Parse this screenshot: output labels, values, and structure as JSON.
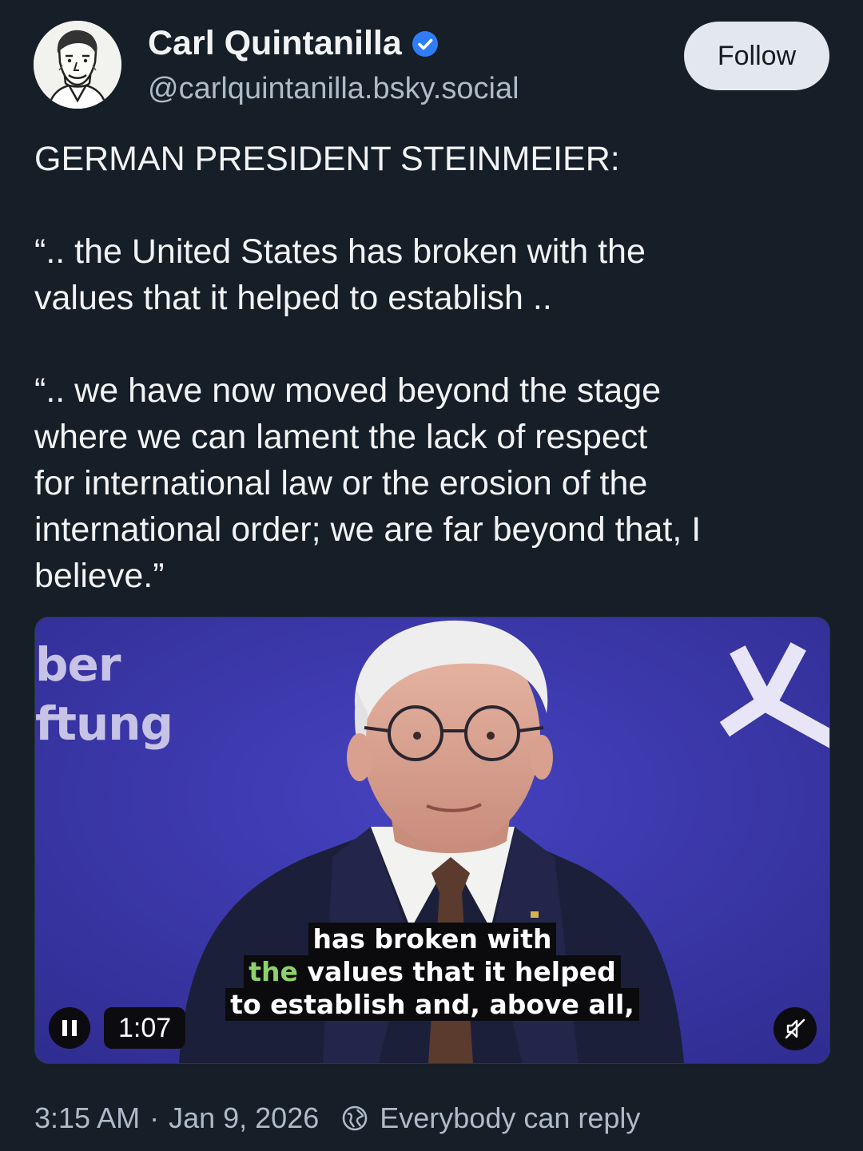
{
  "author": {
    "display_name": "Carl Quintanilla",
    "handle": "@carlquintanilla.bsky.social",
    "verified_icon": "verified-check-icon",
    "avatar_icon": "avatar-illustration"
  },
  "follow_button": {
    "label": "Follow"
  },
  "post": {
    "paragraphs": [
      "GERMAN PRESIDENT STEINMEIER:",
      "“.. the United States has broken with the\nvalues that it helped to establish ..",
      "“.. we have now moved beyond the stage\nwhere we can lament the lack of respect\nfor international law or the erosion of the\ninternational order; we are far beyond that, I\nbelieve.”"
    ]
  },
  "video": {
    "backdrop_text": [
      "ber",
      "ftung"
    ],
    "caption_lines": [
      {
        "plain": "has broken with"
      },
      {
        "highlight": "the",
        "rest": " values that it helped"
      },
      {
        "plain": "to establish and, above all,"
      }
    ],
    "time": "1:07",
    "play_state_icon": "pause-icon",
    "mute_icon": "muted-speaker-icon",
    "colors": {
      "backdrop": "#3b38a8",
      "caption_highlight": "#8fd16a"
    }
  },
  "meta": {
    "time": "3:15 AM",
    "separator": "·",
    "date": "Jan 9, 2026",
    "reply_setting": "Everybody can reply",
    "reply_icon": "globe-reply-icon"
  },
  "colors": {
    "background": "#161e27",
    "text": "#f1f3f5",
    "muted": "#aebbc9",
    "verified": "#2f7df6",
    "follow_bg": "#e3e8ee"
  }
}
